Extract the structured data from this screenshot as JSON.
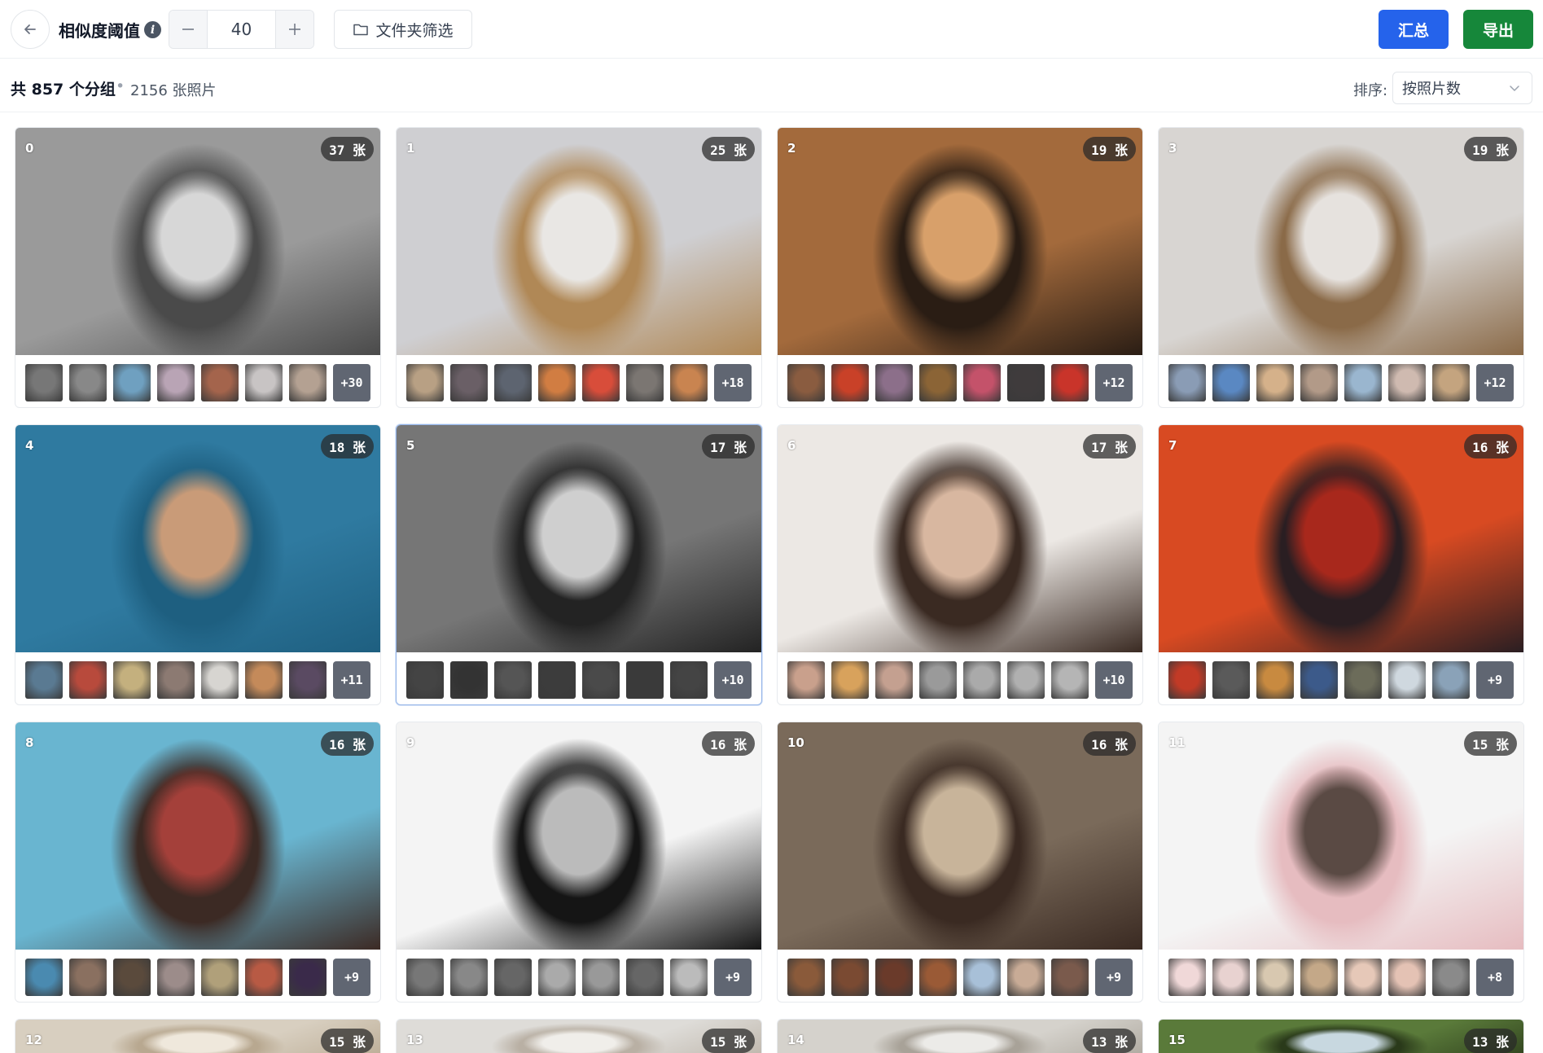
{
  "toolbar": {
    "threshold_label": "相似度阈值",
    "threshold_value": "40",
    "folder_filter_label": "文件夹筛选",
    "summary_label": "汇总",
    "export_label": "导出"
  },
  "stats": {
    "groups_text": "共 857 个分组",
    "separator": "•",
    "photos_text": "2156 张照片",
    "sort_label": "排序:",
    "sort_value": "按照片数"
  },
  "colors": {
    "primary": "#2563eb",
    "export": "#16873a",
    "badge": "#606672"
  },
  "groups": [
    {
      "id": "0",
      "count": "37 张",
      "more": "+30",
      "photo": [
        "#9a9a9a",
        "#4a4a4a",
        "#d7d7d7"
      ],
      "thumbs": [
        "#777",
        "#888",
        "#6fa0c0",
        "#b9a4b5",
        "#a4644c",
        "#c8c4c4",
        "#b4a192"
      ]
    },
    {
      "id": "1",
      "count": "25 张",
      "more": "+18",
      "photo": [
        "#cfcfd2",
        "#b08856",
        "#e9e7e4"
      ],
      "thumbs": [
        "#b8a084",
        "#6a5f66",
        "#5d6470",
        "#d17d42",
        "#d84d3a",
        "#7b7672",
        "#c98450"
      ]
    },
    {
      "id": "2",
      "count": "19 张",
      "more": "+12",
      "photo": [
        "#a36a3c",
        "#2a1d14",
        "#d8a06a"
      ],
      "thumbs": [
        "#8a5c40",
        "#c94128",
        "#8c6f8a",
        "#8b6436",
        "#c4526a",
        "#3f3b3c",
        "#c9342a"
      ]
    },
    {
      "id": "3",
      "count": "19 张",
      "more": "+12",
      "photo": [
        "#d8d5d2",
        "#8a6a48",
        "#e6e2de"
      ],
      "thumbs": [
        "#8a9cb5",
        "#5a88c2",
        "#d5b18a",
        "#b29a88",
        "#9ab6cf",
        "#cfbab0",
        "#c4a47f"
      ]
    },
    {
      "id": "4",
      "count": "18 张",
      "more": "+11",
      "photo": [
        "#2f7aa0",
        "#1e5f80",
        "#c99b78"
      ],
      "thumbs": [
        "#5a7a92",
        "#b84a3c",
        "#c4b07e",
        "#8c7a72",
        "#d7d5d1",
        "#c48a5a",
        "#5a4a62"
      ]
    },
    {
      "id": "5",
      "count": "17 张",
      "more": "+10",
      "photo": [
        "#767676",
        "#232323",
        "#cfcfcf"
      ],
      "thumbs": [
        "#444",
        "#333",
        "#555",
        "#3c3c3c",
        "#4a4a4a",
        "#3a3a3a",
        "#444"
      ]
    },
    {
      "id": "6",
      "count": "17 张",
      "more": "+10",
      "photo": [
        "#ece8e4",
        "#3a2a22",
        "#d8b7a0"
      ],
      "thumbs": [
        "#c9a08c",
        "#d8a25c",
        "#c4a090",
        "#9a9a9a",
        "#aaa",
        "#b0b0b0",
        "#b5b5b5"
      ]
    },
    {
      "id": "7",
      "count": "16 张",
      "more": "+9",
      "photo": [
        "#d84a22",
        "#2a1e22",
        "#a8281c"
      ],
      "thumbs": [
        "#c23a26",
        "#5a5a5a",
        "#c88a40",
        "#3c5a8a",
        "#6c6c5a",
        "#cfd8df",
        "#8aa2b8"
      ]
    },
    {
      "id": "8",
      "count": "16 张",
      "more": "+9",
      "photo": [
        "#69b5d0",
        "#3c2a24",
        "#a4403a"
      ],
      "thumbs": [
        "#4a8ab0",
        "#8a7060",
        "#5a4a3c",
        "#9c8c8a",
        "#b0a07a",
        "#b85a44",
        "#3a2a4a"
      ]
    },
    {
      "id": "9",
      "count": "16 张",
      "more": "+9",
      "photo": [
        "#f4f4f4",
        "#151515",
        "#bbbbbb"
      ],
      "thumbs": [
        "#777",
        "#888",
        "#666",
        "#aaa",
        "#999",
        "#666",
        "#bbb"
      ]
    },
    {
      "id": "10",
      "count": "16 张",
      "more": "+9",
      "photo": [
        "#7a6a5a",
        "#3a2a22",
        "#c8b49a"
      ],
      "thumbs": [
        "#8a5a3a",
        "#7a4a32",
        "#6a3a2a",
        "#9a5a36",
        "#a8c0d8",
        "#c8ab96",
        "#7a5a4c"
      ]
    },
    {
      "id": "11",
      "count": "15 张",
      "more": "+8",
      "photo": [
        "#f4f4f4",
        "#e6bcc0",
        "#5a4a44"
      ],
      "thumbs": [
        "#f0d8d8",
        "#e8d2d0",
        "#d8c8b0",
        "#c4a888",
        "#e6c8b8",
        "#e4c2b4",
        "#8a8a8a"
      ]
    },
    {
      "id": "12",
      "count": "15 张",
      "more": "",
      "photo": [
        "#d8cfc0",
        "#b8a890",
        "#efe8dc"
      ],
      "thumbs": []
    },
    {
      "id": "13",
      "count": "15 张",
      "more": "",
      "photo": [
        "#dedcd8",
        "#b9b0a4",
        "#f0eeea"
      ],
      "thumbs": []
    },
    {
      "id": "14",
      "count": "13 张",
      "more": "",
      "photo": [
        "#d5d2cc",
        "#a8a298",
        "#ecebe8"
      ],
      "thumbs": []
    },
    {
      "id": "15",
      "count": "13 张",
      "more": "",
      "photo": [
        "#5a7a3a",
        "#2a3a1a",
        "#c8d8e0"
      ],
      "thumbs": []
    }
  ]
}
